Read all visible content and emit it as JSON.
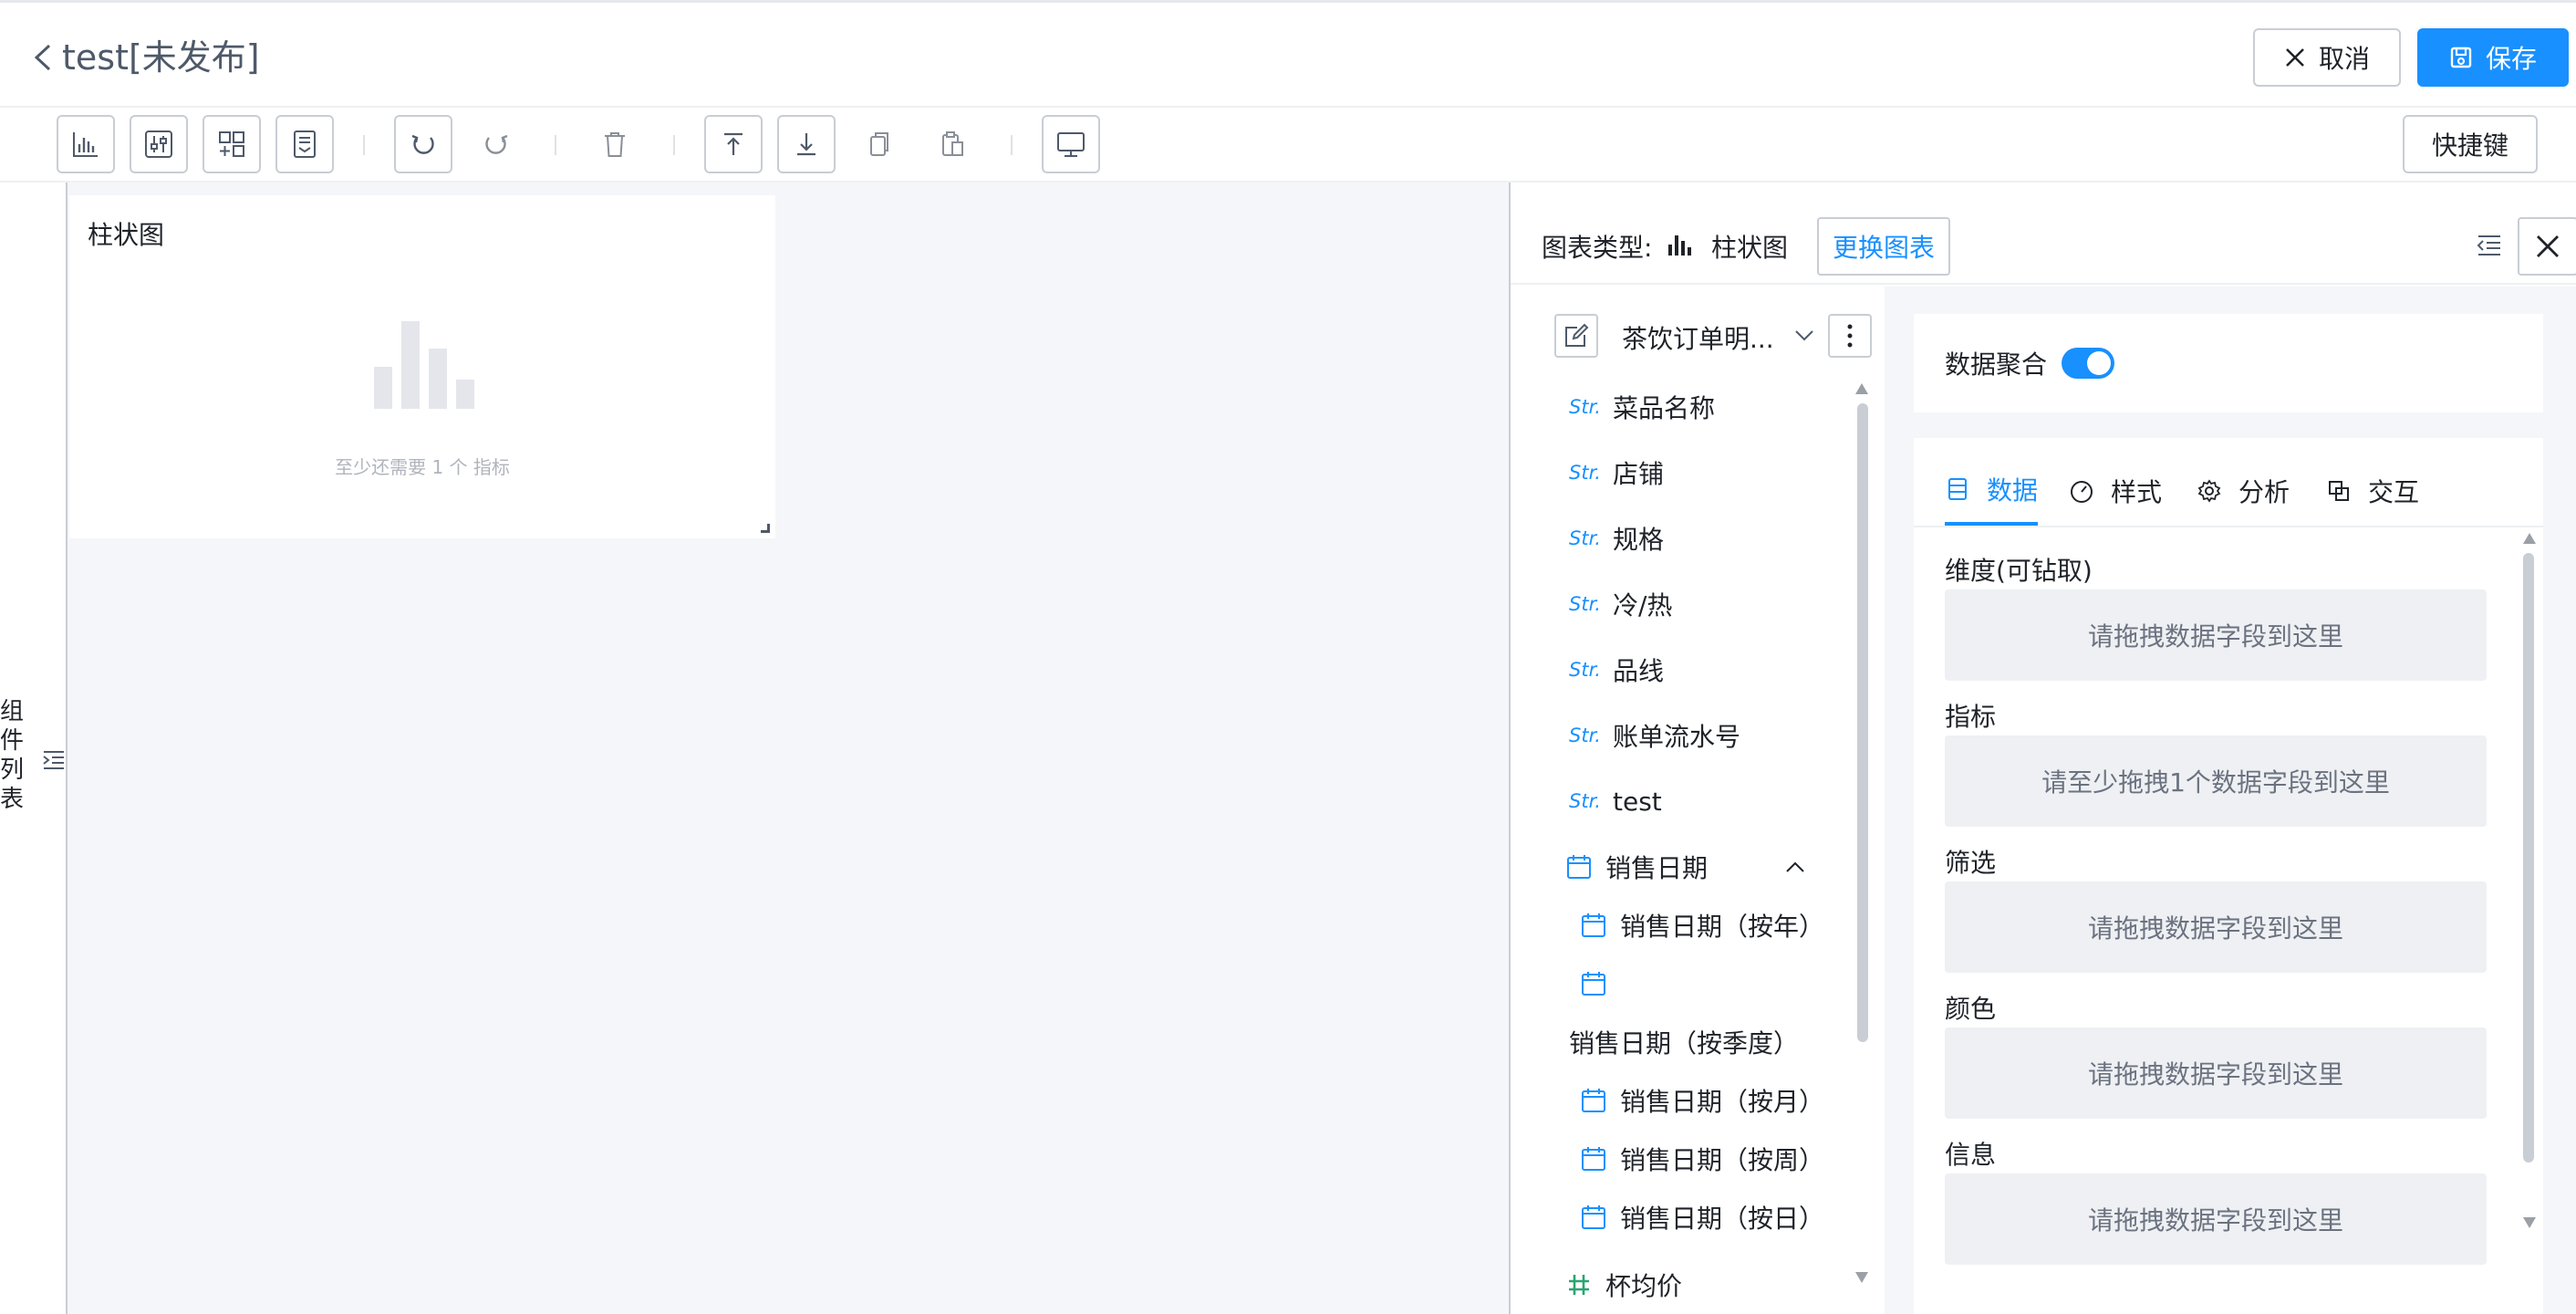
{
  "header": {
    "title": "test[未发布]",
    "cancel_label": "取消",
    "save_label": "保存"
  },
  "toolbar": {
    "shortcut_label": "快捷键",
    "tools": [
      "bar-chart-icon",
      "filter-control-icon",
      "add-component-icon",
      "report-icon",
      "undo-icon",
      "redo-icon",
      "delete-icon",
      "move-top-icon",
      "move-bottom-icon",
      "copy-icon",
      "paste-icon",
      "preview-icon"
    ]
  },
  "left_rail": {
    "label": "组件列表"
  },
  "canvas": {
    "card_title": "柱状图",
    "placeholder": "至少还需要 1 个 指标"
  },
  "editor": {
    "chart_type_label": "图表类型:",
    "chart_type_name": "柱状图",
    "change_chart_label": "更换图表",
    "dataset_name": "茶饮订单明...",
    "fields": [
      {
        "tag": "Str.",
        "name": "菜品名称"
      },
      {
        "tag": "Str.",
        "name": "店铺"
      },
      {
        "tag": "Str.",
        "name": "规格"
      },
      {
        "tag": "Str.",
        "name": "冷/热"
      },
      {
        "tag": "Str.",
        "name": "品线"
      },
      {
        "tag": "Str.",
        "name": "账单流水号"
      },
      {
        "tag": "Str.",
        "name": "test"
      }
    ],
    "date_group": {
      "name": "销售日期",
      "year": "销售日期（按年）",
      "quarter": "销售日期（按季度）",
      "month": "销售日期（按月）",
      "week": "销售日期（按周）",
      "day": "销售日期（按日）"
    },
    "measure_partial": "杯均价",
    "aggregation_label": "数据聚合",
    "aggregation_on": true,
    "tabs": [
      "数据",
      "样式",
      "分析",
      "交互"
    ],
    "slots": [
      {
        "label": "维度(可钻取)",
        "placeholder": "请拖拽数据字段到这里"
      },
      {
        "label": "指标",
        "placeholder": "请至少拖拽1个数据字段到这里"
      },
      {
        "label": "筛选",
        "placeholder": "请拖拽数据字段到这里"
      },
      {
        "label": "颜色",
        "placeholder": "请拖拽数据字段到这里"
      },
      {
        "label": "信息",
        "placeholder": "请拖拽数据字段到这里"
      }
    ]
  },
  "colors": {
    "accent": "#1890ff",
    "text": "#1f2329",
    "muted": "#6b7280",
    "canvas_bg": "#f4f6f9",
    "border": "#c9cdd4"
  }
}
